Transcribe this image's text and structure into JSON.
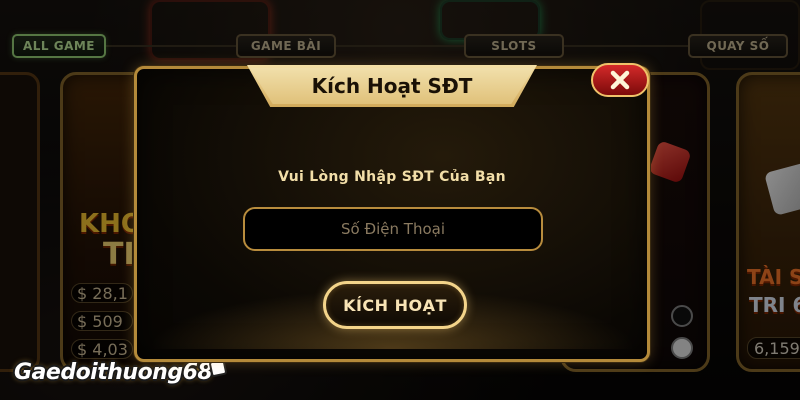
{
  "tabs": {
    "all_game": "ALL GAME",
    "game_bai": "GAME BÀI",
    "slots": "SLOTS",
    "quay_so": "QUAY SỐ"
  },
  "cards": {
    "card1_title": "KHO",
    "card1_sub": "TI",
    "card3_title": "TÀI S",
    "card3_sub": "TRI 6",
    "jackpots_left": [
      "$ 28,1",
      "$ 509",
      "$ 4,03"
    ],
    "jackpot_right": "6,159"
  },
  "watermark": "Gaedoithuong68",
  "modal": {
    "title": "Kích Hoạt SĐT",
    "prompt": "Vui Lòng Nhập SĐT Của Bạn",
    "phone_placeholder": "Số Điện Thoại",
    "phone_value": "",
    "activate_label": "KÍCH HOẠT"
  },
  "colors": {
    "gold_border": "#b48a3a",
    "title_plate": "#e8c98a",
    "close_red": "#c41f1f",
    "active_tab_green": "#9bd77a"
  },
  "icons": {
    "close": "close-icon"
  }
}
